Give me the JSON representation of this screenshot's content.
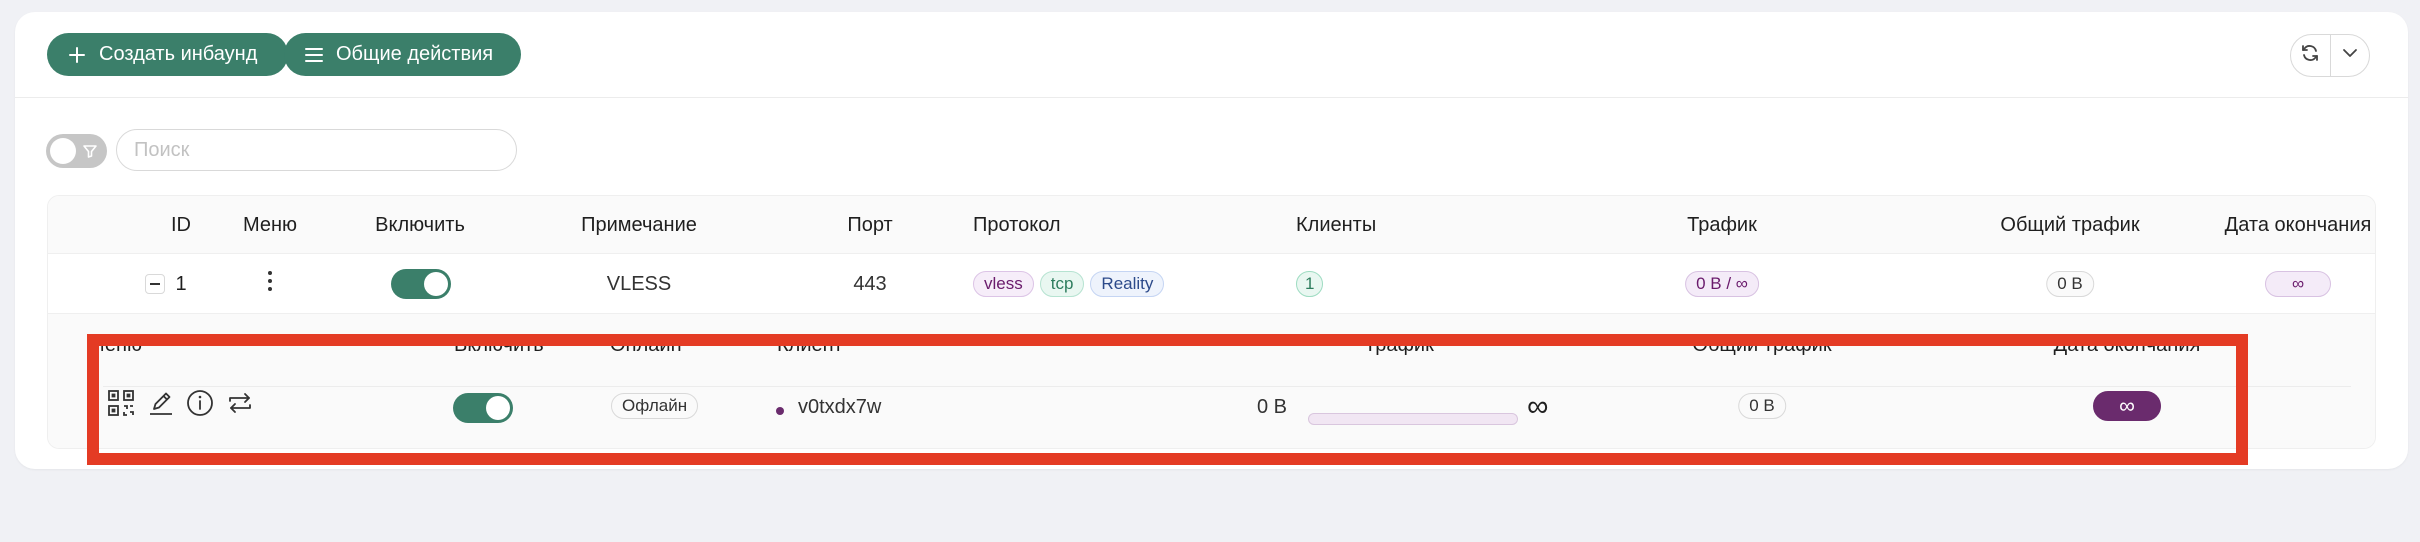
{
  "toolbar": {
    "create_label": "Создать инбаунд",
    "general_label": "Общие действия"
  },
  "filter": {
    "search_placeholder": "Поиск"
  },
  "table": {
    "headers": {
      "id": "ID",
      "menu": "Меню",
      "enable": "Включить",
      "remark": "Примечание",
      "port": "Порт",
      "protocol": "Протокол",
      "clients": "Клиенты",
      "traffic": "Трафик",
      "total_traffic": "Общий трафик",
      "expiry": "Дата окончания"
    },
    "row": {
      "id": "1",
      "enabled": true,
      "remark": "VLESS",
      "port": "443",
      "protocol_tags": [
        "vless",
        "tcp",
        "Reality"
      ],
      "clients_count": "1",
      "traffic": "0 B / ∞",
      "total_traffic": "0 B",
      "expiry": "∞"
    }
  },
  "clients_table": {
    "headers": {
      "menu": "Меню",
      "enable": "Включить",
      "online": "Онлайн",
      "client": "Клиент",
      "traffic": "Трафик",
      "total_traffic": "Общий трафик",
      "expiry": "Дата окончания"
    },
    "row": {
      "enabled": true,
      "online_status": "Офлайн",
      "client_name": "v0txdx7w",
      "traffic_used": "0 B",
      "traffic_limit": "∞",
      "traffic_fraction": 0,
      "total_traffic": "0 B",
      "expiry": "∞"
    }
  },
  "colors": {
    "primary": "#3b7f6a",
    "accent_purple": "#6a2b6d",
    "highlight_red": "#e43b24"
  }
}
